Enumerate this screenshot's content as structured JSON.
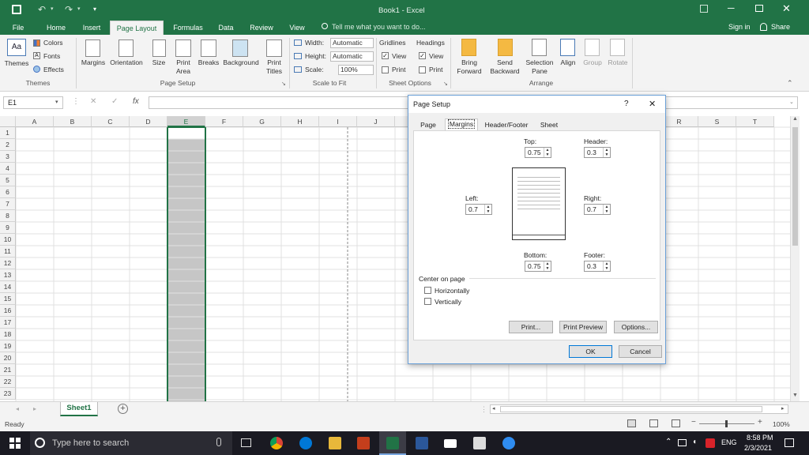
{
  "window": {
    "title": "Book1 - Excel",
    "qat_customize": "▾"
  },
  "account": {
    "signin": "Sign in",
    "share": "Share"
  },
  "tabs": [
    "File",
    "Home",
    "Insert",
    "Page Layout",
    "Formulas",
    "Data",
    "Review",
    "View"
  ],
  "tellme": "Tell me what you want to do...",
  "ribbon": {
    "themes_group": {
      "themes": "Themes",
      "colors": "Colors",
      "fonts": "Fonts",
      "effects": "Effects",
      "label": "Themes"
    },
    "page_setup": {
      "margins": "Margins",
      "orientation": "Orientation",
      "size": "Size",
      "print_area_1": "Print",
      "print_area_2": "Area",
      "breaks": "Breaks",
      "background": "Background",
      "print_titles_1": "Print",
      "print_titles_2": "Titles",
      "label": "Page Setup"
    },
    "scale": {
      "width_label": "Width:",
      "width_value": "Automatic",
      "height_label": "Height:",
      "height_value": "Automatic",
      "scale_label": "Scale:",
      "scale_value": "100%",
      "label": "Scale to Fit"
    },
    "sheet_options": {
      "gridlines": "Gridlines",
      "headings": "Headings",
      "view": "View",
      "print": "Print",
      "label": "Sheet Options"
    },
    "arrange": {
      "bring_1": "Bring",
      "bring_2": "Forward",
      "send_1": "Send",
      "send_2": "Backward",
      "sel_1": "Selection",
      "sel_2": "Pane",
      "align": "Align",
      "group": "Group",
      "rotate": "Rotate",
      "label": "Arrange"
    }
  },
  "formula": {
    "name_box": "E1",
    "fx": "fx",
    "cancel": "✕",
    "enter": "✓"
  },
  "columns": [
    "A",
    "B",
    "C",
    "D",
    "E",
    "F",
    "G",
    "H",
    "I",
    "J",
    "K",
    "L",
    "M",
    "N",
    "O",
    "P",
    "Q",
    "R",
    "S",
    "T"
  ],
  "rows": [
    "1",
    "2",
    "3",
    "4",
    "5",
    "6",
    "7",
    "8",
    "9",
    "10",
    "11",
    "12",
    "13",
    "14",
    "15",
    "16",
    "17",
    "18",
    "19",
    "20",
    "21",
    "22",
    "23"
  ],
  "selected_column": "E",
  "sheet_tab": "Sheet1",
  "status": {
    "ready": "Ready",
    "zoom": "100%"
  },
  "taskbar": {
    "search": "Type here to search",
    "lang": "ENG",
    "time": "8:58 PM",
    "date": "2/3/2021"
  },
  "dialog": {
    "title": "Page Setup",
    "help": "?",
    "close": "✕",
    "tabs": [
      "Page",
      "Margins",
      "Header/Footer",
      "Sheet"
    ],
    "active_tab": "Margins",
    "top_label": "Top:",
    "top_value": "0.75",
    "header_label": "Header:",
    "header_value": "0.3",
    "left_label": "Left:",
    "left_value": "0.7",
    "right_label": "Right:",
    "right_value": "0.7",
    "bottom_label": "Bottom:",
    "bottom_value": "0.75",
    "footer_label": "Footer:",
    "footer_value": "0.3",
    "center_label": "Center on page",
    "horizontally": "Horizontally",
    "vertically": "Vertically",
    "print_btn": "Print...",
    "preview_btn": "Print Preview",
    "options_btn": "Options...",
    "ok": "OK",
    "cancel": "Cancel"
  }
}
